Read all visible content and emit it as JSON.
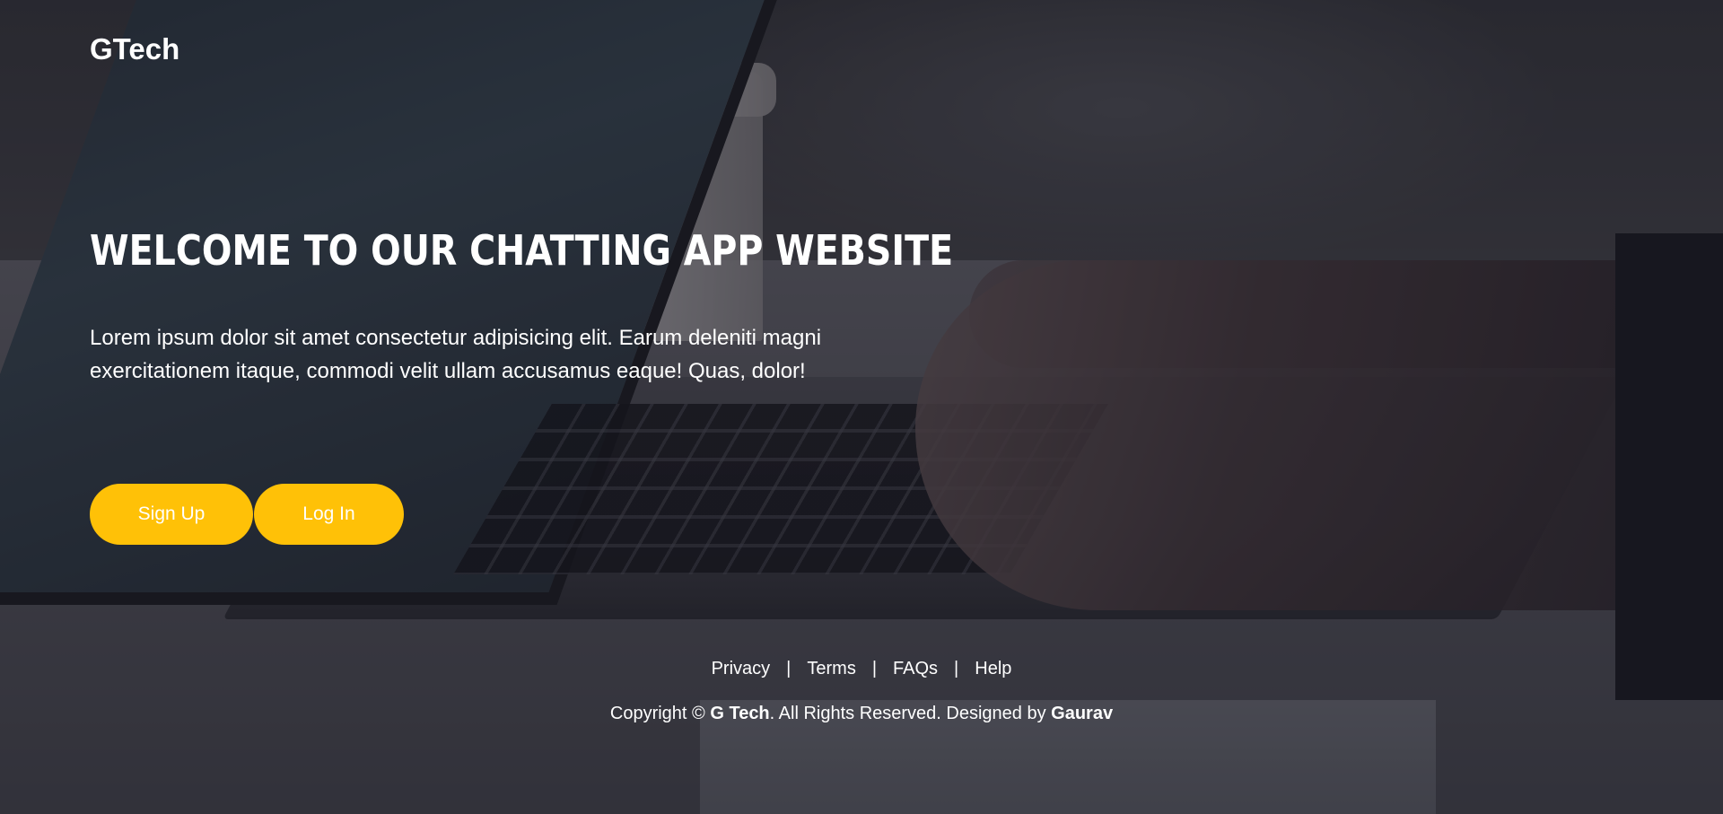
{
  "brand": "GTech",
  "hero": {
    "title": "Welcome To Our Chatting App Website",
    "text": "Lorem ipsum dolor sit amet consectetur adipisicing elit. Earum deleniti magni exercitationem itaque, commodi velit ullam accusamus eaque! Quas, dolor!"
  },
  "buttons": {
    "signup": "Sign Up",
    "login": "Log In"
  },
  "footer": {
    "links": [
      "Privacy",
      "Terms",
      "FAQs",
      "Help"
    ],
    "separator": "|",
    "copyright_prefix": "Copyright ©",
    "copyright_company": "G Tech",
    "copyright_middle": ". All Rights Reserved. Designed by",
    "copyright_designer": "Gaurav"
  },
  "colors": {
    "button_bg": "#ffc107",
    "text": "#ffffff",
    "overlay": "#14141c"
  }
}
